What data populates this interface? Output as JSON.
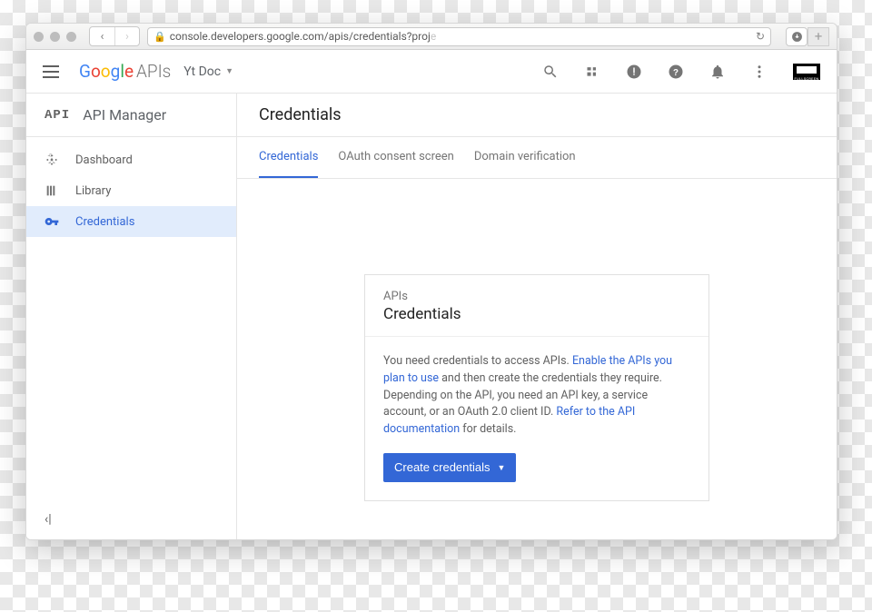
{
  "browser": {
    "url_host": "console.developers.google.com",
    "url_path": "/apis/credentials?proj",
    "url_fade": "e"
  },
  "header": {
    "logo_suffix": "APIs",
    "project": "Yt Doc"
  },
  "sidebar": {
    "title": "API Manager",
    "items": [
      {
        "label": "Dashboard"
      },
      {
        "label": "Library"
      },
      {
        "label": "Credentials"
      }
    ]
  },
  "main": {
    "title": "Credentials",
    "tabs": [
      {
        "label": "Credentials"
      },
      {
        "label": "OAuth consent screen"
      },
      {
        "label": "Domain verification"
      }
    ],
    "card": {
      "subtitle": "APIs",
      "title": "Credentials",
      "text_a": "You need credentials to access APIs. ",
      "link_a": "Enable the APIs you plan to use",
      "text_b": " and then create the credentials they require. Depending on the API, you need an API key, a service account, or an OAuth 2.0 client ID. ",
      "link_b": "Refer to the API documentation",
      "text_c": " for details.",
      "button": "Create credentials"
    }
  }
}
